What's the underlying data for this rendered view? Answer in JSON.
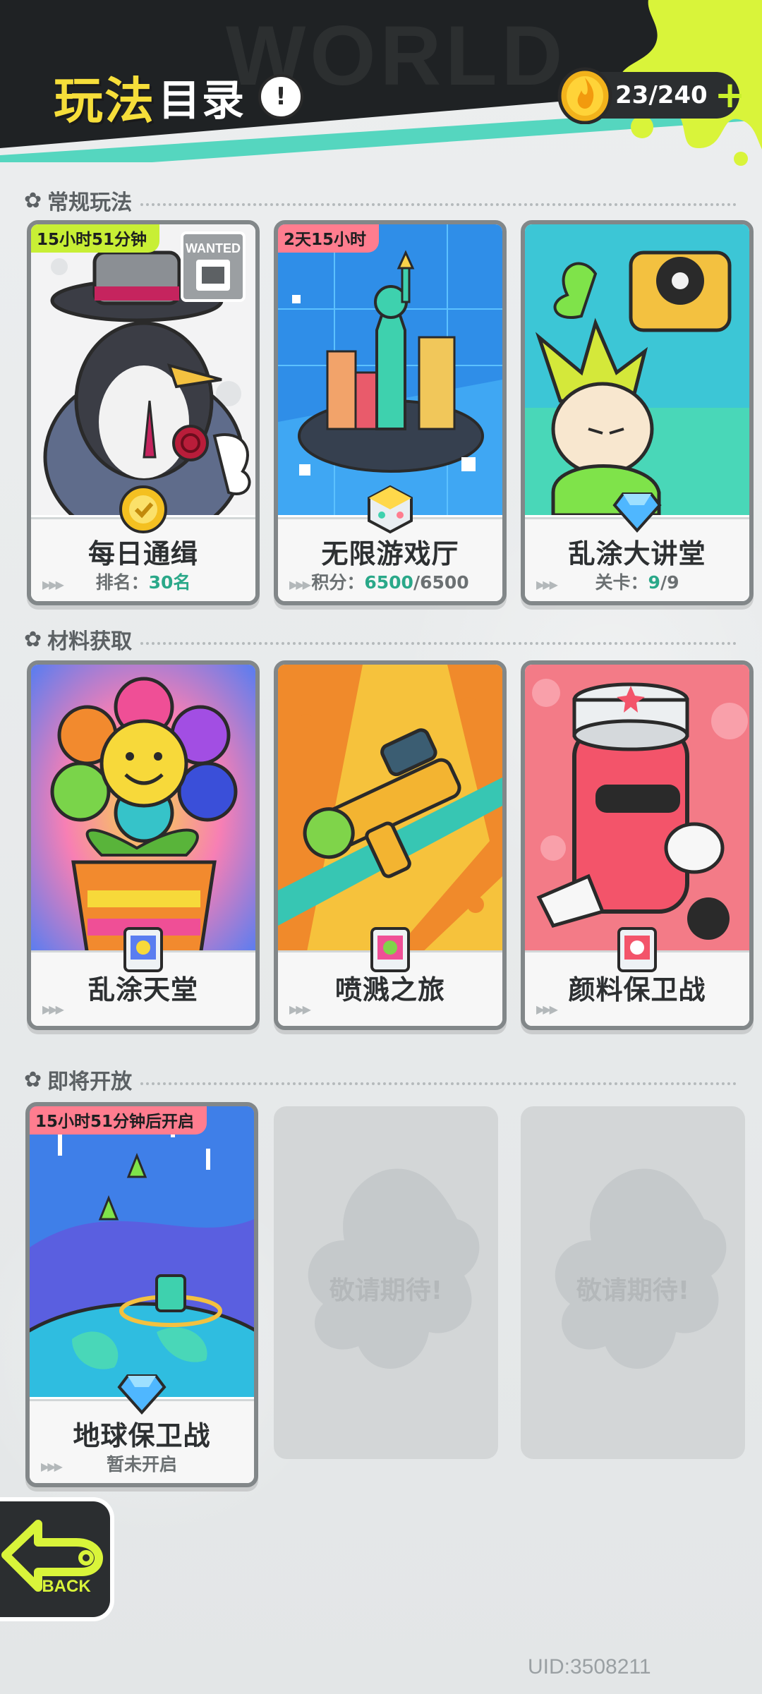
{
  "header": {
    "title_part1": "玩法",
    "title_part2": "目录",
    "info_icon": "!",
    "energy": "23/240",
    "energy_plus": "+"
  },
  "sections": [
    {
      "title": "常规玩法",
      "cards": [
        {
          "name": "每日通缉",
          "sub_label": "排名：",
          "sub_value": "30名",
          "sub_total": "",
          "timer": "15小时51分钟",
          "timer_color": "#c8ef35",
          "extra": "WANTED"
        },
        {
          "name": "无限游戏厅",
          "sub_label": "积分：",
          "sub_value": "6500",
          "sub_total": "/6500",
          "timer": "2天15小时",
          "timer_color": "#ff7d8f"
        },
        {
          "name": "乱涂大讲堂",
          "sub_label": "关卡：",
          "sub_value": "9",
          "sub_total": "/9",
          "timer": ""
        }
      ]
    },
    {
      "title": "材料获取",
      "cards": [
        {
          "name": "乱涂天堂"
        },
        {
          "name": "喷溅之旅"
        },
        {
          "name": "颜料保卫战"
        }
      ]
    },
    {
      "title": "即将开放",
      "cards": [
        {
          "name": "地球保卫战",
          "sub_label": "暂未开启",
          "timer": "15小时51分钟后开启",
          "timer_color": "#ff7d8f"
        },
        {
          "placeholder": "敬请期待!"
        },
        {
          "placeholder": "敬请期待!"
        }
      ]
    }
  ],
  "back_label": "BACK",
  "uid": "UID:3508211",
  "colors": {
    "accent_yellow": "#f6de3a",
    "accent_lime": "#c8ef35",
    "accent_teal": "#55d6bf",
    "value_green": "#2aa889"
  }
}
